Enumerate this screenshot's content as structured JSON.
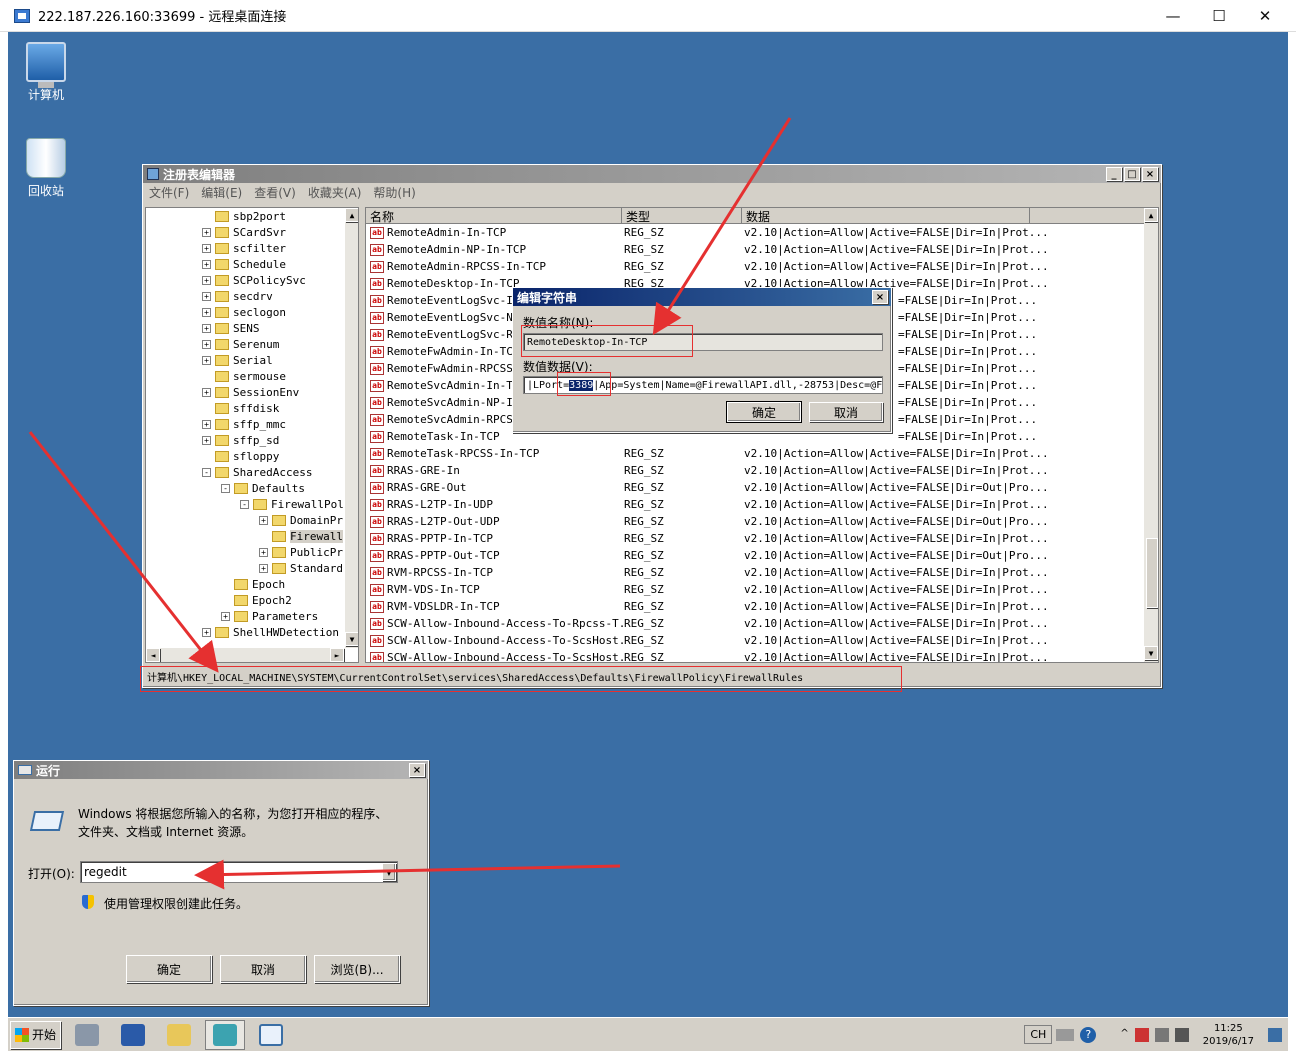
{
  "rdp": {
    "title": "222.187.226.160:33699 - 远程桌面连接",
    "min": "—",
    "max": "☐",
    "close": "✕"
  },
  "desktop": {
    "icons": [
      {
        "label": "计算机",
        "icon": "computer-icon"
      },
      {
        "label": "回收站",
        "icon": "recycle-bin-icon"
      }
    ]
  },
  "regedit": {
    "title": "注册表编辑器",
    "menu": [
      "文件(F)",
      "编辑(E)",
      "查看(V)",
      "收藏夹(A)",
      "帮助(H)"
    ],
    "tree": [
      {
        "label": "sbp2port",
        "indent": 0,
        "expand": ""
      },
      {
        "label": "SCardSvr",
        "indent": 0,
        "expand": "+"
      },
      {
        "label": "scfilter",
        "indent": 0,
        "expand": "+"
      },
      {
        "label": "Schedule",
        "indent": 0,
        "expand": "+"
      },
      {
        "label": "SCPolicySvc",
        "indent": 0,
        "expand": "+"
      },
      {
        "label": "secdrv",
        "indent": 0,
        "expand": "+"
      },
      {
        "label": "seclogon",
        "indent": 0,
        "expand": "+"
      },
      {
        "label": "SENS",
        "indent": 0,
        "expand": "+"
      },
      {
        "label": "Serenum",
        "indent": 0,
        "expand": "+"
      },
      {
        "label": "Serial",
        "indent": 0,
        "expand": "+"
      },
      {
        "label": "sermouse",
        "indent": 0,
        "expand": ""
      },
      {
        "label": "SessionEnv",
        "indent": 0,
        "expand": "+"
      },
      {
        "label": "sffdisk",
        "indent": 0,
        "expand": ""
      },
      {
        "label": "sffp_mmc",
        "indent": 0,
        "expand": "+"
      },
      {
        "label": "sffp_sd",
        "indent": 0,
        "expand": "+"
      },
      {
        "label": "sfloppy",
        "indent": 0,
        "expand": ""
      },
      {
        "label": "SharedAccess",
        "indent": 0,
        "expand": "-"
      },
      {
        "label": "Defaults",
        "indent": 1,
        "expand": "-"
      },
      {
        "label": "FirewallPol",
        "indent": 2,
        "expand": "-"
      },
      {
        "label": "DomainPr",
        "indent": 3,
        "expand": "+"
      },
      {
        "label": "Firewall",
        "indent": 3,
        "expand": ""
      },
      {
        "label": "PublicPr",
        "indent": 3,
        "expand": "+"
      },
      {
        "label": "Standard",
        "indent": 3,
        "expand": "+"
      },
      {
        "label": "Epoch",
        "indent": 1,
        "expand": ""
      },
      {
        "label": "Epoch2",
        "indent": 1,
        "expand": ""
      },
      {
        "label": "Parameters",
        "indent": 1,
        "expand": "+"
      },
      {
        "label": "ShellHWDetection",
        "indent": 0,
        "expand": "+"
      }
    ],
    "columns": [
      "名称",
      "类型",
      "数据"
    ],
    "rows": [
      {
        "name": "RemoteAdmin-In-TCP",
        "type": "REG_SZ",
        "data": "v2.10|Action=Allow|Active=FALSE|Dir=In|Prot..."
      },
      {
        "name": "RemoteAdmin-NP-In-TCP",
        "type": "REG_SZ",
        "data": "v2.10|Action=Allow|Active=FALSE|Dir=In|Prot..."
      },
      {
        "name": "RemoteAdmin-RPCSS-In-TCP",
        "type": "REG_SZ",
        "data": "v2.10|Action=Allow|Active=FALSE|Dir=In|Prot..."
      },
      {
        "name": "RemoteDesktop-In-TCP",
        "type": "REG_SZ",
        "data": "v2.10|Action=Allow|Active=FALSE|Dir=In|Prot..."
      },
      {
        "name": "RemoteEventLogSvc-In-",
        "type": "",
        "data": "=FALSE|Dir=In|Prot..."
      },
      {
        "name": "RemoteEventLogSvc-NP-",
        "type": "",
        "data": "=FALSE|Dir=In|Prot..."
      },
      {
        "name": "RemoteEventLogSvc-RPC",
        "type": "",
        "data": "=FALSE|Dir=In|Prot..."
      },
      {
        "name": "RemoteFwAdmin-In-TCP",
        "type": "",
        "data": "=FALSE|Dir=In|Prot..."
      },
      {
        "name": "RemoteFwAdmin-RPCSS-I",
        "type": "",
        "data": "=FALSE|Dir=In|Prot..."
      },
      {
        "name": "RemoteSvcAdmin-In-TCP",
        "type": "",
        "data": "=FALSE|Dir=In|Prot..."
      },
      {
        "name": "RemoteSvcAdmin-NP-In-",
        "type": "",
        "data": "=FALSE|Dir=In|Prot..."
      },
      {
        "name": "RemoteSvcAdmin-RPCSS-",
        "type": "",
        "data": "=FALSE|Dir=In|Prot..."
      },
      {
        "name": "RemoteTask-In-TCP",
        "type": "",
        "data": "=FALSE|Dir=In|Prot..."
      },
      {
        "name": "RemoteTask-RPCSS-In-TCP",
        "type": "REG_SZ",
        "data": "v2.10|Action=Allow|Active=FALSE|Dir=In|Prot..."
      },
      {
        "name": "RRAS-GRE-In",
        "type": "REG_SZ",
        "data": "v2.10|Action=Allow|Active=FALSE|Dir=In|Prot..."
      },
      {
        "name": "RRAS-GRE-Out",
        "type": "REG_SZ",
        "data": "v2.10|Action=Allow|Active=FALSE|Dir=Out|Pro..."
      },
      {
        "name": "RRAS-L2TP-In-UDP",
        "type": "REG_SZ",
        "data": "v2.10|Action=Allow|Active=FALSE|Dir=In|Prot..."
      },
      {
        "name": "RRAS-L2TP-Out-UDP",
        "type": "REG_SZ",
        "data": "v2.10|Action=Allow|Active=FALSE|Dir=Out|Pro..."
      },
      {
        "name": "RRAS-PPTP-In-TCP",
        "type": "REG_SZ",
        "data": "v2.10|Action=Allow|Active=FALSE|Dir=In|Prot..."
      },
      {
        "name": "RRAS-PPTP-Out-TCP",
        "type": "REG_SZ",
        "data": "v2.10|Action=Allow|Active=FALSE|Dir=Out|Pro..."
      },
      {
        "name": "RVM-RPCSS-In-TCP",
        "type": "REG_SZ",
        "data": "v2.10|Action=Allow|Active=FALSE|Dir=In|Prot..."
      },
      {
        "name": "RVM-VDS-In-TCP",
        "type": "REG_SZ",
        "data": "v2.10|Action=Allow|Active=FALSE|Dir=In|Prot..."
      },
      {
        "name": "RVM-VDSLDR-In-TCP",
        "type": "REG_SZ",
        "data": "v2.10|Action=Allow|Active=FALSE|Dir=In|Prot..."
      },
      {
        "name": "SCW-Allow-Inbound-Access-To-Rpcss-T...",
        "type": "REG_SZ",
        "data": "v2.10|Action=Allow|Active=FALSE|Dir=In|Prot..."
      },
      {
        "name": "SCW-Allow-Inbound-Access-To-ScsHost...",
        "type": "REG_SZ",
        "data": "v2.10|Action=Allow|Active=FALSE|Dir=In|Prot..."
      },
      {
        "name": "SCW-Allow-Inbound-Access-To-ScsHost...",
        "type": "REG_SZ",
        "data": "v2.10|Action=Allow|Active=FALSE|Dir=In|Prot..."
      }
    ],
    "status": "计算机\\HKEY_LOCAL_MACHINE\\SYSTEM\\CurrentControlSet\\services\\SharedAccess\\Defaults\\FirewallPolicy\\FirewallRules"
  },
  "edit_dialog": {
    "title": "编辑字符串",
    "name_label": "数值名称(N):",
    "name_value": "RemoteDesktop-In-TCP",
    "data_label": "数值数据(V):",
    "data_pre": "|LPort=",
    "data_sel": "3389",
    "data_post": "|App=System|Name=@FirewallAPI.dll,-28753|Desc=@F",
    "ok": "确定",
    "cancel": "取消"
  },
  "run_dialog": {
    "title": "运行",
    "desc1": "Windows 将根据您所输入的名称，为您打开相应的程序、",
    "desc2": "文件夹、文档或 Internet 资源。",
    "open_label": "打开(O):",
    "value": "regedit",
    "admin_note": "使用管理权限创建此任务。",
    "ok": "确定",
    "cancel": "取消",
    "browse": "浏览(B)..."
  },
  "taskbar": {
    "start": "开始",
    "lang": "CH",
    "help": "?",
    "time": "11:25",
    "date": "2019/6/17"
  },
  "colors": {
    "desktop": "#3a6ea5",
    "title_active": "#0a246a",
    "arrow": "#e53030"
  }
}
